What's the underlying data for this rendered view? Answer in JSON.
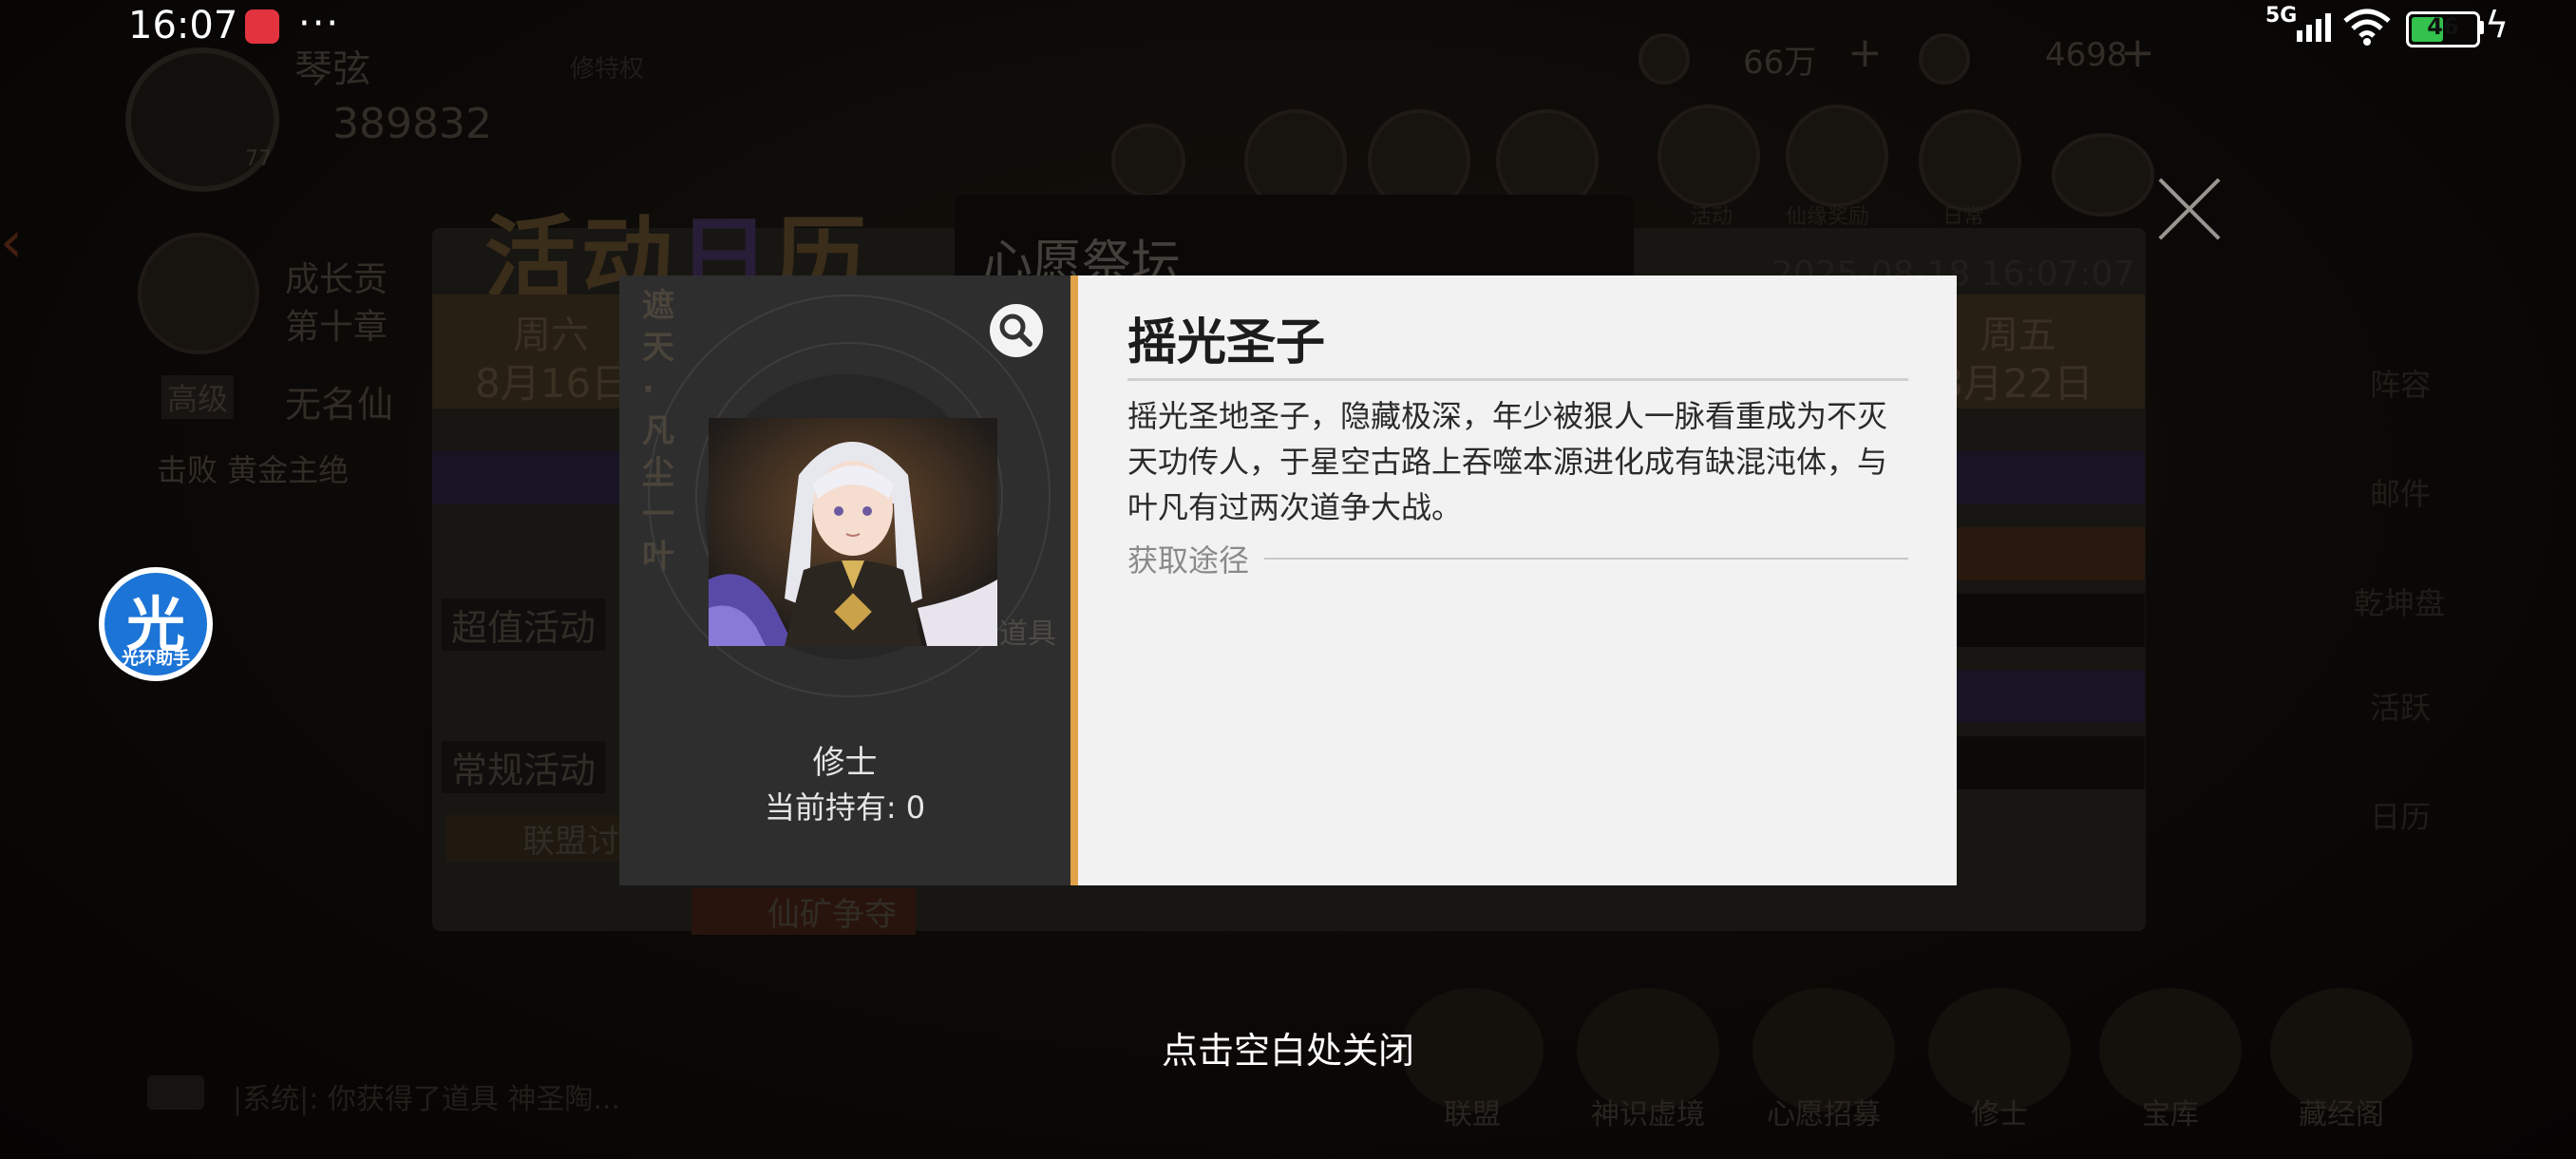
{
  "status_bar": {
    "time": "16:07",
    "more": "···",
    "network": "5G",
    "battery": "46"
  },
  "background": {
    "player_name": "琴弦",
    "player_power": "389832",
    "player_level": "77",
    "tag": "修特权",
    "currency_1": "66万",
    "currency_2": "4698",
    "growth": "成长贡",
    "growth_2": "第十章",
    "tier": "高级",
    "unnamed": "无名仙",
    "defeat": "击败 黄金主绝",
    "calendar_title_a": "活动",
    "calendar_title_b": "日",
    "calendar_title_c": "历",
    "tab_title": "心愿祭坛",
    "datetime": "2025-08-18  16:07:07",
    "day_left_name": "周六",
    "day_left_date": "8月16日",
    "day_right_name": "周五",
    "day_right_date": "8月22日",
    "section_value": "超值活动",
    "section_regular": "常规活动",
    "alliance": "联盟讨",
    "mine": "仙矿争夺",
    "side_menu": [
      "阵容",
      "邮件",
      "乾坤盘",
      "活跃",
      "日历"
    ],
    "top_menu": [
      "活动",
      "仙缘奖励",
      "日常"
    ],
    "bottom_nav": [
      "联盟",
      "神识虚境",
      "心愿招募",
      "修士",
      "宝库",
      "藏经阁"
    ],
    "chat_line": "|系统|: 你获得了道具 神圣陶..."
  },
  "helper": {
    "big": "光",
    "small": "光环助手"
  },
  "item": {
    "name": "摇光圣子",
    "type": "修士",
    "owned_label": "当前持有:",
    "owned_count": "0",
    "vertical_text": "遮天·凡尘一叶",
    "tool_label": "道具",
    "description": "摇光圣地圣子，隐藏极深，年少被狠人一脉看重成为不灭天功传人，于星空古路上吞噬本源进化成有缺混沌体，与叶凡有过两次道争大战。",
    "obtain_label": "获取途径"
  },
  "close_hint": "点击空白处关闭",
  "colors": {
    "accent": "#e1a24a",
    "panel_light": "#f2f2f2",
    "panel_dark": "#2e2e2e",
    "helper_blue": "#1c74d6"
  }
}
